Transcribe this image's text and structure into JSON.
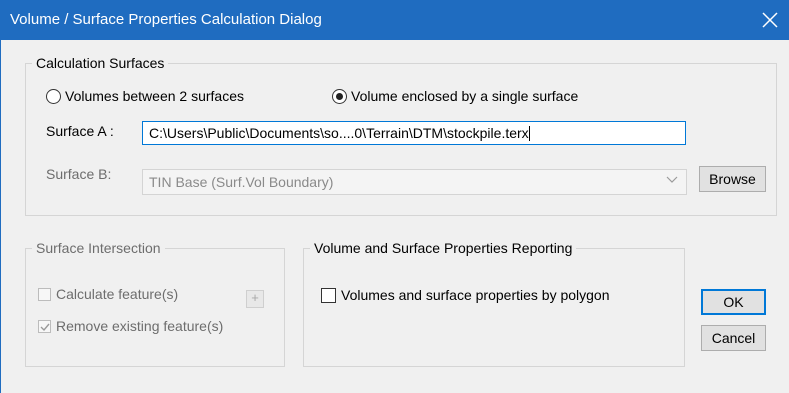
{
  "window": {
    "title": "Volume / Surface Properties Calculation Dialog",
    "close_glyph": "close-icon"
  },
  "calc_surfaces": {
    "title": "Calculation Surfaces",
    "radio_two": {
      "label": "Volumes between 2 surfaces",
      "selected": false
    },
    "radio_single": {
      "label": "Volume enclosed by a single surface",
      "selected": true
    },
    "surface_a": {
      "label": "Surface A :",
      "value": "C:\\Users\\Public\\Documents\\so....0\\Terrain\\DTM\\stockpile.terx"
    },
    "surface_b": {
      "label": "Surface B:",
      "value": "TIN Base (Surf.Vol Boundary)"
    },
    "browse_label": "Browse"
  },
  "surface_intersection": {
    "title": "Surface Intersection",
    "calc_features": {
      "label": "Calculate feature(s)",
      "checked": false
    },
    "plus_label": "+",
    "remove_existing": {
      "label": "Remove existing feature(s)",
      "checked": true
    }
  },
  "reporting": {
    "title": "Volume and Surface Properties Reporting",
    "by_polygon": {
      "label": "Volumes and surface properties by polygon",
      "checked": false
    }
  },
  "buttons": {
    "ok": "OK",
    "cancel": "Cancel"
  }
}
